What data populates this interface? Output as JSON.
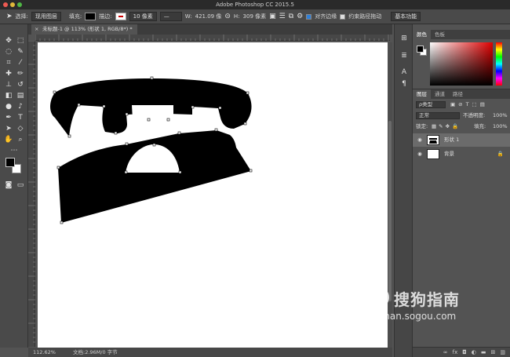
{
  "window": {
    "title": "Adobe Photoshop CC 2015.5"
  },
  "options_bar": {
    "select_label": "选择:",
    "select_value": "现用图层",
    "fill_label": "填充:",
    "stroke_label": "描边:",
    "stroke_width": "10 像素",
    "w_label": "W:",
    "w_value": "421.09 像",
    "h_label": "H:",
    "h_value": "309 像素",
    "align_edges_label": "对齐边缘",
    "constrain_path_label": "约束路径拖动",
    "workspace": "基本功能"
  },
  "document": {
    "tab_title": "未标题-1 @ 113% (形状 1, RGB/8*) *",
    "close_glyph": "×"
  },
  "status": {
    "zoom": "112.62%",
    "doc_info": "文档:2.96M/0 字节"
  },
  "color_panel": {
    "tabs": [
      "颜色",
      "色板"
    ]
  },
  "layers_panel": {
    "tabs": [
      "图层",
      "通道",
      "路径"
    ],
    "filter_kind": "ρ类型",
    "blend_mode": "正常",
    "opacity_label": "不透明度:",
    "opacity_value": "100%",
    "lock_label": "锁定:",
    "fill_label": "填充:",
    "fill_value": "100%",
    "layers": [
      {
        "name": "形状 1",
        "selected": true
      },
      {
        "name": "背景",
        "selected": false,
        "locked": true
      }
    ]
  },
  "tool_icons": [
    "move-icon",
    "marquee-icon",
    "lasso-icon",
    "quick-select-icon",
    "crop-icon",
    "eyedropper-icon",
    "healing-brush-icon",
    "brush-icon",
    "clone-stamp-icon",
    "history-brush-icon",
    "eraser-icon",
    "gradient-icon",
    "blur-icon",
    "dodge-icon",
    "pen-icon",
    "type-icon",
    "path-select-icon",
    "direct-select-icon",
    "hand-icon",
    "zoom-icon"
  ],
  "watermark": {
    "logo_glyph": "S",
    "text_cn": "搜狗指南",
    "url": "zhinan.sogou.com"
  },
  "colors": {
    "foreground": "#000000",
    "background": "#ffffff",
    "shape_fill": "#000000"
  }
}
